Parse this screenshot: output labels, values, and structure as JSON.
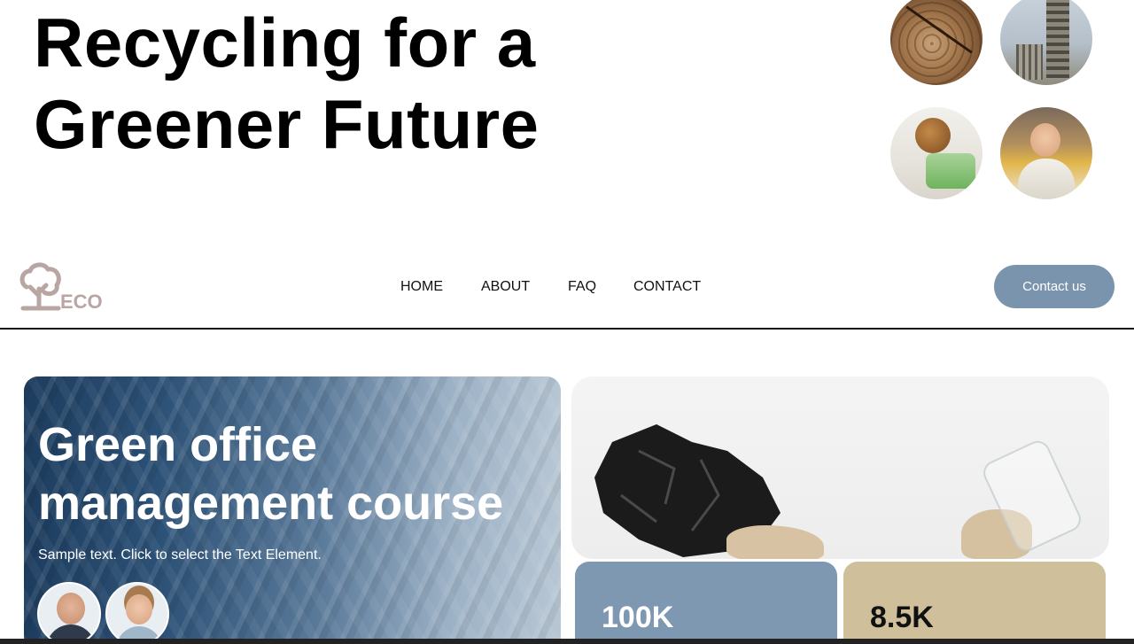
{
  "hero": {
    "title_line1": "Recycling for a",
    "title_line2": "Greener Future",
    "images": [
      "wood-stump-photo",
      "factory-photo",
      "recycled-items-photo",
      "woman-recycling-photo"
    ]
  },
  "logo": {
    "text": "ECO",
    "color": "#b9a6a3",
    "icon": "tree-icon"
  },
  "nav": {
    "items": [
      {
        "label": "HOME"
      },
      {
        "label": "ABOUT"
      },
      {
        "label": "FAQ"
      },
      {
        "label": "CONTACT"
      }
    ],
    "cta_label": "Contact us",
    "cta_color": "#7b94ae"
  },
  "course_card": {
    "title_line1": "Green office",
    "title_line2": "management course",
    "text": "Sample text. Click to select the Text Element.",
    "avatars": [
      "man-with-glasses-avatar",
      "smiling-woman-avatar"
    ]
  },
  "stats": [
    {
      "value": "100K",
      "color": "#7f98b2"
    },
    {
      "value": "8.5K",
      "color": "#cfc09b"
    }
  ]
}
